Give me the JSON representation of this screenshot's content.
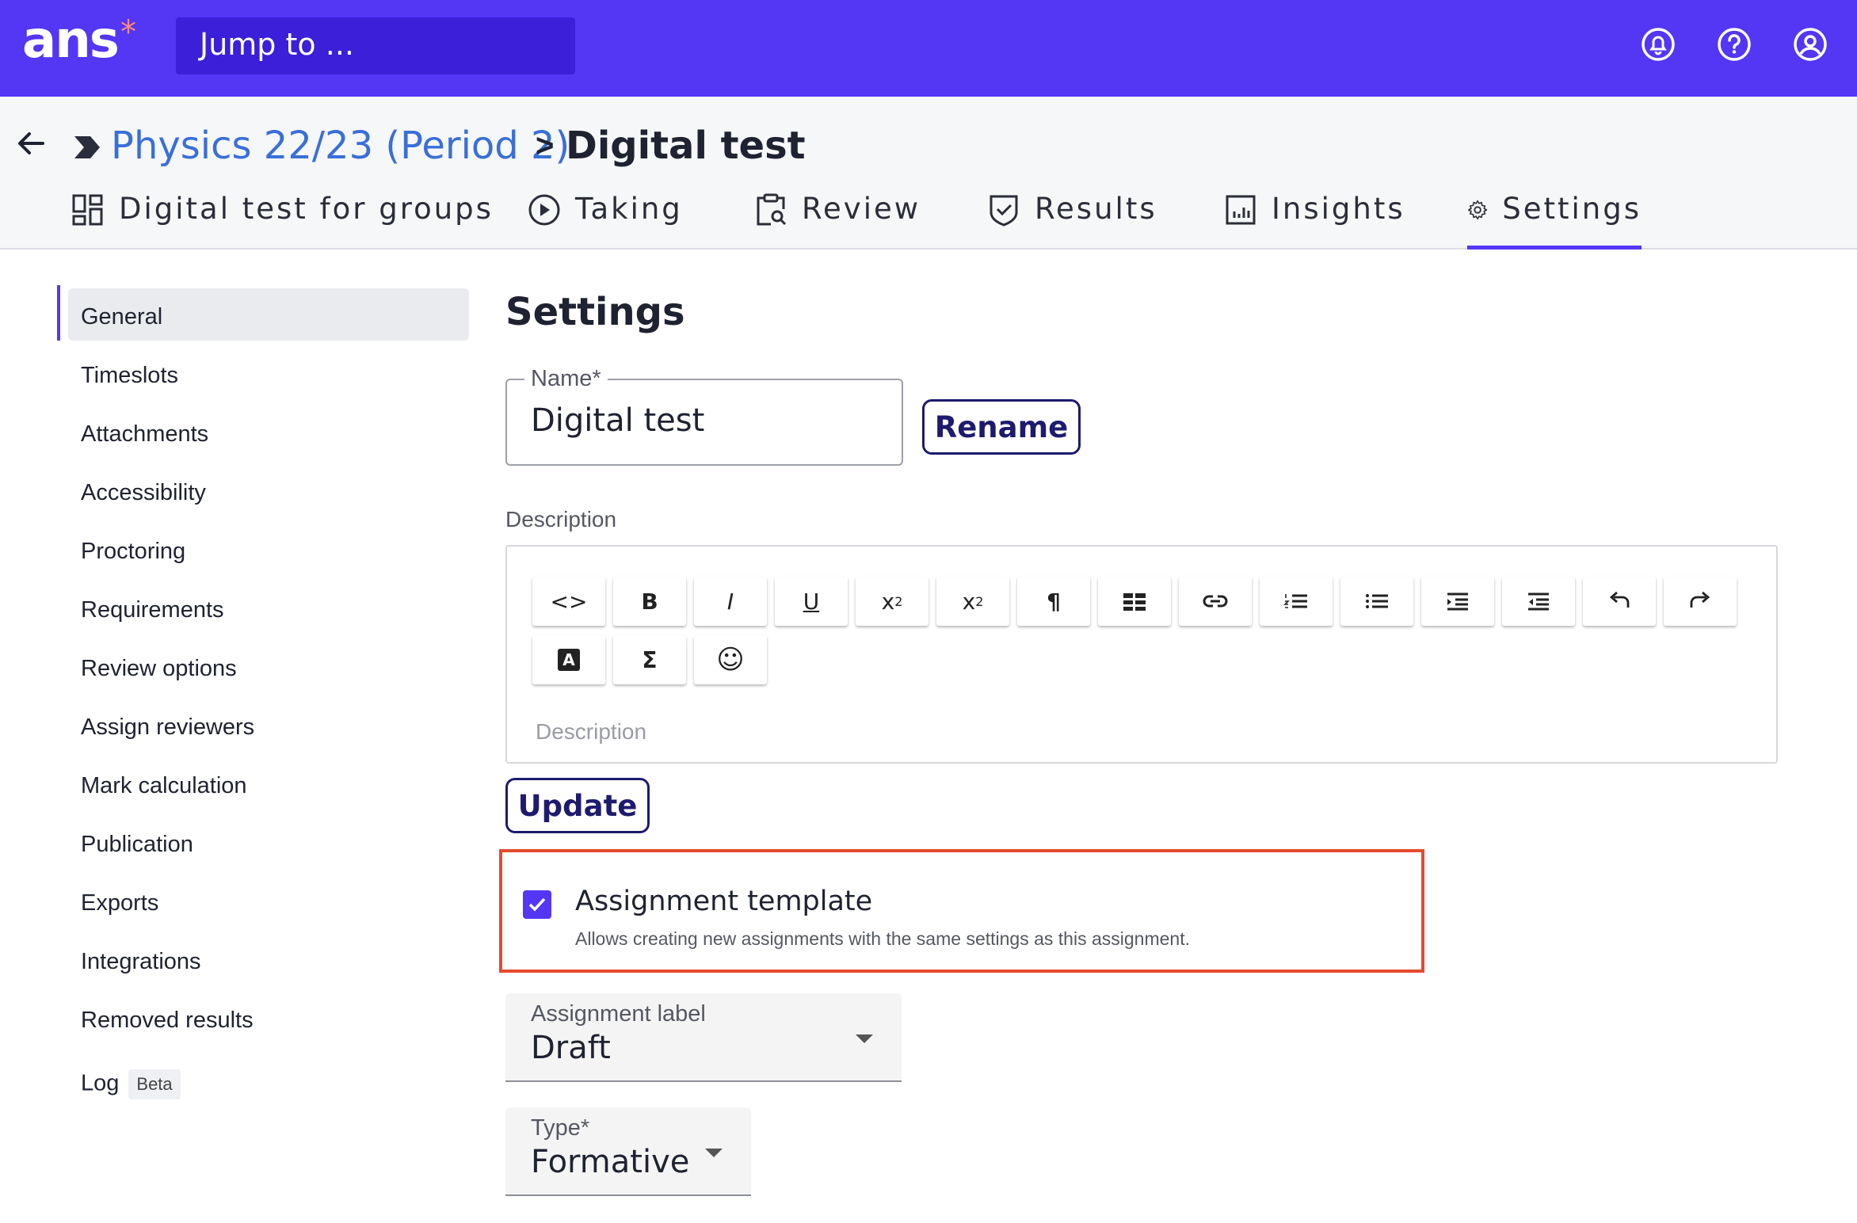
{
  "header": {
    "logo": "ans",
    "logo_mark": "*",
    "search_placeholder": "Jump to ..."
  },
  "breadcrumb": {
    "parent": "Physics 22/23 (Period 2)",
    "separator": ">",
    "current": "Digital test"
  },
  "tabs": [
    {
      "label": "Digital test for groups",
      "icon": "grid-icon"
    },
    {
      "label": "Taking",
      "icon": "play-circle-icon"
    },
    {
      "label": "Review",
      "icon": "clipboard-search-icon"
    },
    {
      "label": "Results",
      "icon": "shield-check-icon"
    },
    {
      "label": "Insights",
      "icon": "bar-chart-icon"
    },
    {
      "label": "Settings",
      "icon": "gear-icon",
      "active": true
    }
  ],
  "sidebar": {
    "items": [
      {
        "label": "General",
        "active": true
      },
      {
        "label": "Timeslots"
      },
      {
        "label": "Attachments"
      },
      {
        "label": "Accessibility"
      },
      {
        "label": "Proctoring"
      },
      {
        "label": "Requirements"
      },
      {
        "label": "Review options"
      },
      {
        "label": "Assign reviewers"
      },
      {
        "label": "Mark calculation"
      },
      {
        "label": "Publication"
      },
      {
        "label": "Exports"
      },
      {
        "label": "Integrations"
      },
      {
        "label": "Removed results"
      },
      {
        "label": "Log",
        "badge": "Beta"
      }
    ]
  },
  "main": {
    "title": "Settings",
    "name_field": {
      "label": "Name*",
      "value": "Digital test"
    },
    "rename_label": "Rename",
    "description_label": "Description",
    "description_placeholder": "Description",
    "toolbar": {
      "code": "<>",
      "bold": "B",
      "italic": "I",
      "underline": "U",
      "subscript": "x",
      "subscript_mark": "2",
      "superscript": "x",
      "superscript_mark": "2",
      "paragraph": "¶",
      "sigma": "Σ",
      "emoji": "☺",
      "text_color": "A"
    },
    "update_label": "Update",
    "assignment_template": {
      "checked": true,
      "title": "Assignment template",
      "help": "Allows creating new assignments with the same settings as this assignment."
    },
    "assignment_label": {
      "label": "Assignment label",
      "value": "Draft"
    },
    "type": {
      "label": "Type*",
      "value": "Formative"
    }
  },
  "colors": {
    "brand": "#5436f5",
    "link": "#3a6fd8",
    "highlight": "#e54a2e"
  }
}
